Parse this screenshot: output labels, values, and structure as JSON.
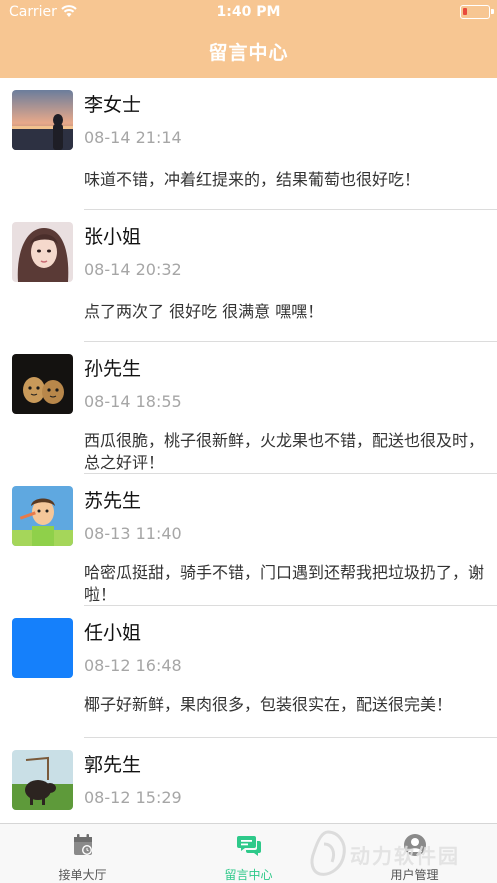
{
  "status_bar": {
    "carrier": "Carrier",
    "time": "1:40 PM"
  },
  "nav": {
    "title": "留言中心"
  },
  "messages": [
    {
      "name": "李女士",
      "time": "08-14 21:14",
      "text": "味道不错，冲着红提来的，结果葡萄也很好吃！",
      "avatar": "sunset-woman"
    },
    {
      "name": "张小姐",
      "time": "08-14 20:32",
      "text": "点了两次了 很好吃 很满意 嘿嘿！",
      "avatar": "girl-portrait"
    },
    {
      "name": "孙先生",
      "time": "08-14 18:55",
      "text": "西瓜很脆，桃子很新鲜，火龙果也不错，配送也很及时，总之好评！",
      "avatar": "eggs"
    },
    {
      "name": "苏先生",
      "time": "08-13 11:40",
      "text": "哈密瓜挺甜，骑手不错，门口遇到还帮我把垃圾扔了，谢啦！",
      "avatar": "cartoon-man"
    },
    {
      "name": "任小姐",
      "time": "08-12 16:48",
      "text": "椰子好新鲜，果肉很多，包装很实在，配送很完美！",
      "avatar": "blue-square"
    },
    {
      "name": "郭先生",
      "time": "08-12 15:29",
      "text": "",
      "avatar": "pig-field"
    }
  ],
  "tabs": [
    {
      "label": "接单大厅",
      "icon": "calendar-icon",
      "active": false
    },
    {
      "label": "留言中心",
      "icon": "chat-icon",
      "active": true
    },
    {
      "label": "用户管理",
      "icon": "user-badge-icon",
      "active": false
    }
  ],
  "watermark": {
    "text": "动力软件园"
  },
  "colors": {
    "header": "#f7c692",
    "accent": "#2ec98a",
    "time_gray": "#a6a6a6"
  }
}
